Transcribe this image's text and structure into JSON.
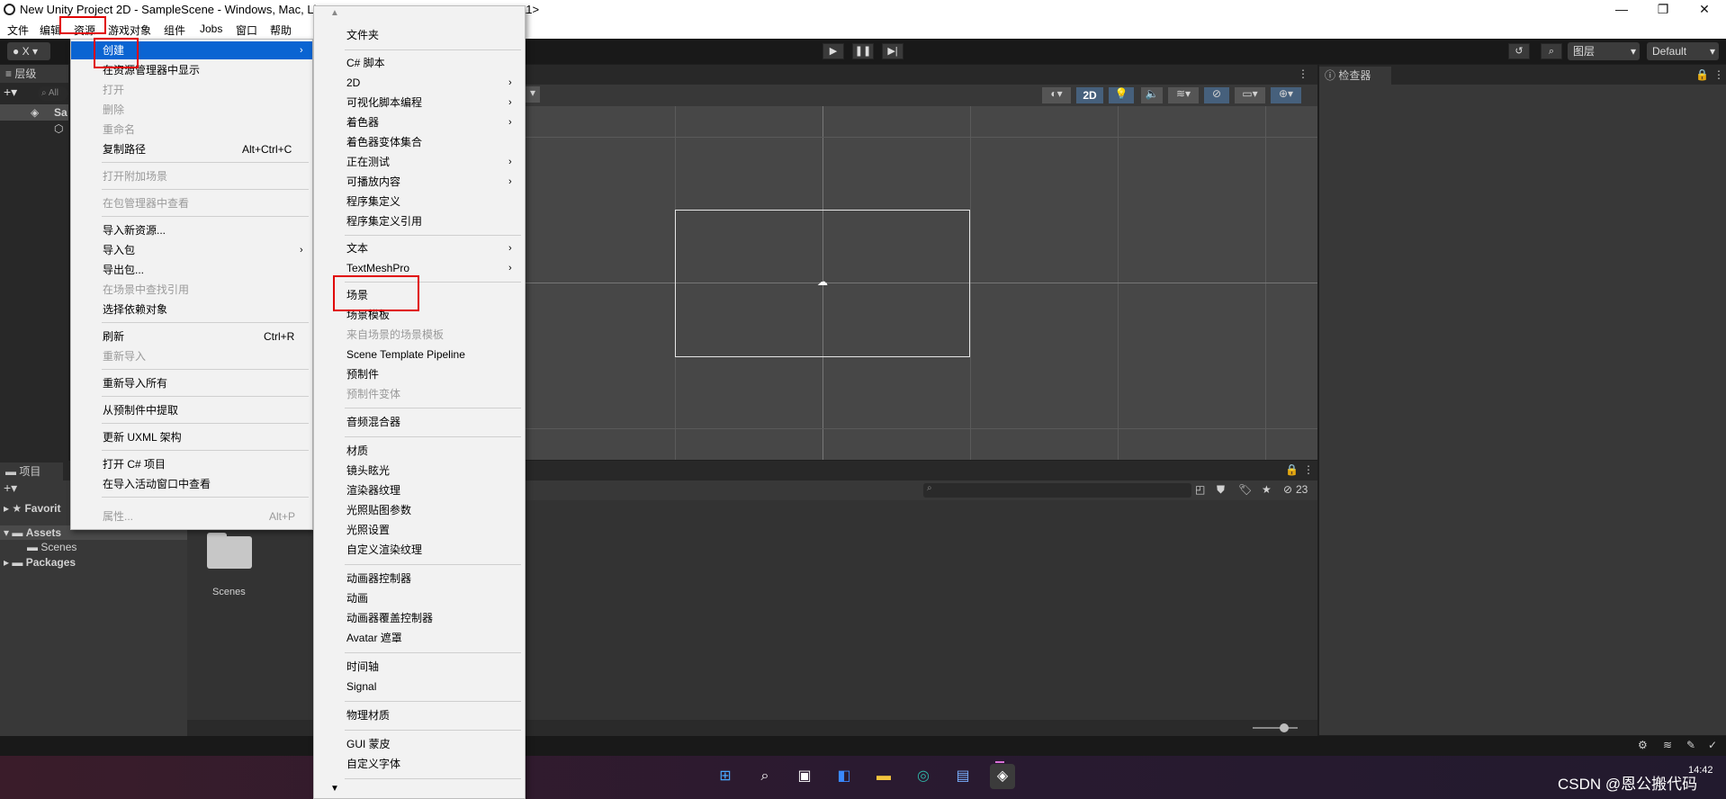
{
  "window": {
    "title": "New Unity Project 2D - SampleScene - Windows, Mac, Li",
    "title_tail": "11>"
  },
  "menubar": {
    "items": [
      "文件",
      "编辑",
      "资源",
      "游戏对象",
      "组件",
      "Jobs",
      "窗口",
      "帮助"
    ]
  },
  "toolbar": {
    "layers_label": "图层",
    "layout_label": "Default",
    "account_label": "X"
  },
  "hierarchy": {
    "tab": "层级",
    "search_placeholder": "All",
    "scene_item": "Sa"
  },
  "inspector": {
    "tab": "检查器"
  },
  "scene_view": {
    "mode_2d": "2D"
  },
  "project": {
    "tab": "项目",
    "favorites": "Favorit",
    "assets": "Assets",
    "scenes": "Scenes",
    "packages": "Packages",
    "folder_label": "Scenes",
    "hidden_count": "23"
  },
  "assets_menu": {
    "items": [
      {
        "label": "创建",
        "highlighted": true,
        "submenu": true
      },
      {
        "label": "在资源管理器中显示"
      },
      {
        "label": "打开",
        "disabled": true
      },
      {
        "label": "删除",
        "disabled": true
      },
      {
        "label": "重命名",
        "disabled": true
      },
      {
        "label": "复制路径",
        "shortcut": "Alt+Ctrl+C"
      },
      {
        "label": "打开附加场景",
        "disabled": true
      },
      {
        "label": "在包管理器中查看",
        "disabled": true
      },
      {
        "label": "导入新资源..."
      },
      {
        "label": "导入包",
        "submenu": true
      },
      {
        "label": "导出包..."
      },
      {
        "label": "在场景中查找引用",
        "disabled": true
      },
      {
        "label": "选择依赖对象"
      },
      {
        "label": "刷新",
        "shortcut": "Ctrl+R"
      },
      {
        "label": "重新导入",
        "disabled": true
      },
      {
        "label": "重新导入所有"
      },
      {
        "label": "从预制件中提取"
      },
      {
        "label": "更新 UXML 架构"
      },
      {
        "label": "打开 C# 项目"
      },
      {
        "label": "在导入活动窗口中查看"
      },
      {
        "label": "属性...",
        "disabled": true,
        "shortcut": "Alt+P"
      }
    ]
  },
  "create_menu": {
    "items": [
      {
        "label": "文件夹"
      },
      {
        "label": "C# 脚本"
      },
      {
        "label": "2D",
        "submenu": true
      },
      {
        "label": "可视化脚本编程",
        "submenu": true
      },
      {
        "label": "着色器",
        "submenu": true
      },
      {
        "label": "着色器变体集合"
      },
      {
        "label": "正在测试",
        "submenu": true
      },
      {
        "label": "可播放内容",
        "submenu": true
      },
      {
        "label": "程序集定义"
      },
      {
        "label": "程序集定义引用"
      },
      {
        "label": "文本",
        "submenu": true
      },
      {
        "label": "TextMeshPro",
        "submenu": true
      },
      {
        "label": "场景"
      },
      {
        "label": "场景模板"
      },
      {
        "label": "来自场景的场景模板",
        "disabled": true
      },
      {
        "label": "Scene Template Pipeline"
      },
      {
        "label": "预制件"
      },
      {
        "label": "预制件变体",
        "disabled": true
      },
      {
        "label": "音频混合器"
      },
      {
        "label": "材质"
      },
      {
        "label": "镜头眩光"
      },
      {
        "label": "渲染器纹理"
      },
      {
        "label": "光照贴图参数"
      },
      {
        "label": "光照设置"
      },
      {
        "label": "自定义渲染纹理"
      },
      {
        "label": "动画器控制器"
      },
      {
        "label": "动画"
      },
      {
        "label": "动画器覆盖控制器"
      },
      {
        "label": "Avatar 遮罩"
      },
      {
        "label": "时间轴"
      },
      {
        "label": "Signal"
      },
      {
        "label": "物理材质"
      },
      {
        "label": "GUI 蒙皮"
      },
      {
        "label": "自定义字体"
      }
    ]
  },
  "taskbar": {
    "time": "14:42",
    "watermark": "CSDN @恩公搬代码"
  }
}
